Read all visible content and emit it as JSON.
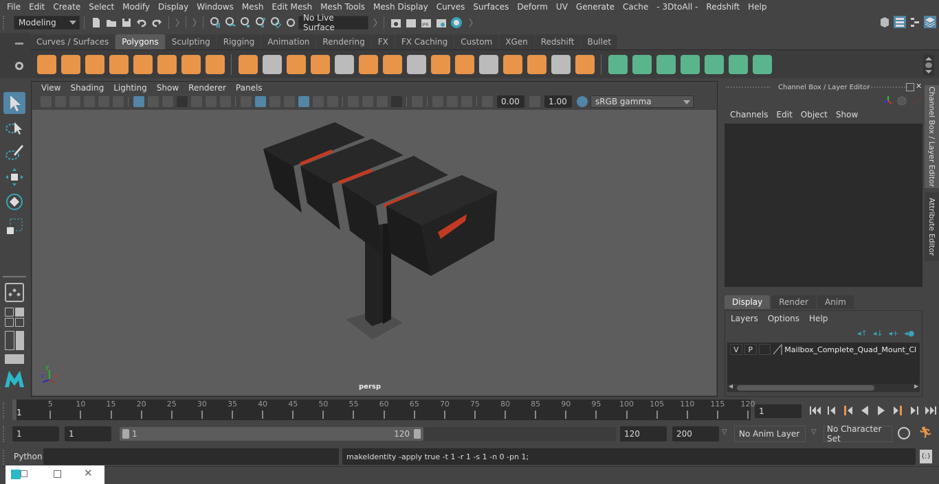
{
  "menubar": {
    "items": [
      "File",
      "Edit",
      "Create",
      "Select",
      "Modify",
      "Display",
      "Windows",
      "Mesh",
      "Edit Mesh",
      "Mesh Tools",
      "Mesh Display",
      "Curves",
      "Surfaces",
      "Deform",
      "UV",
      "Generate",
      "Cache",
      "- 3DtoAll -",
      "Redshift",
      "Help"
    ]
  },
  "statusline": {
    "workspace": "Modeling",
    "live_surface": "No Live Surface"
  },
  "shelf": {
    "tabs": [
      "Curves / Surfaces",
      "Polygons",
      "Sculpting",
      "Rigging",
      "Animation",
      "Rendering",
      "FX",
      "FX Caching",
      "Custom",
      "XGen",
      "Redshift",
      "Bullet"
    ],
    "active_tab": "Polygons",
    "orange_icons": [
      "poly-sphere-icon",
      "poly-cube-icon",
      "poly-cylinder-icon",
      "poly-cone-icon",
      "poly-plane-icon",
      "poly-torus-icon",
      "poly-pyramid-icon",
      "poly-pipe-icon"
    ],
    "edit_icons": [
      "combine-icon",
      "separate-icon",
      "mirror-icon",
      "smooth-icon",
      "extract-icon",
      "bevel-icon",
      "bridge-icon",
      "multicut-icon",
      "extrude-icon",
      "fill-hole-icon",
      "triangulate-icon",
      "merge-icon",
      "edge-loop-icon",
      "target-weld-icon",
      "boolean-icon"
    ],
    "green_icons": [
      "planar-uv-icon",
      "cylindrical-uv-icon",
      "spherical-uv-icon",
      "automatic-uv-icon",
      "unfold-uv-icon",
      "uv-editor-icon",
      "cut-uv-icon"
    ]
  },
  "viewport": {
    "menus": [
      "View",
      "Shading",
      "Lighting",
      "Show",
      "Renderer",
      "Panels"
    ],
    "exposure": "0.00",
    "gamma": "1.00",
    "color_space": "sRGB gamma",
    "camera_label": "persp",
    "axis": {
      "x": "x",
      "y": "y",
      "z": "z"
    }
  },
  "channel_box": {
    "title": "Channel Box / Layer Editor",
    "menus": [
      "Channels",
      "Edit",
      "Object",
      "Show"
    ],
    "layer_tabs": [
      "Display",
      "Render",
      "Anim"
    ],
    "active_layer_tab": "Display",
    "layer_menus": [
      "Layers",
      "Options",
      "Help"
    ],
    "layers": [
      {
        "visible": "V",
        "playback": "P",
        "name": "Mailbox_Complete_Quad_Mount_Clus"
      }
    ]
  },
  "side_tabs": [
    "Channel Box / Layer Editor",
    "Attribute Editor"
  ],
  "timeline": {
    "ticks": [
      5,
      10,
      15,
      20,
      25,
      30,
      35,
      40,
      45,
      50,
      55,
      60,
      65,
      70,
      75,
      80,
      85,
      90,
      95,
      100,
      105,
      110,
      115,
      120
    ],
    "start": 1,
    "end": 120,
    "current_marker": "1",
    "current_frame": "1"
  },
  "range": {
    "start_time": "1",
    "playback_start": "1",
    "slider_start": "1",
    "slider_end": "120",
    "playback_end": "120",
    "end_time": "200",
    "anim_layer": "No Anim Layer",
    "character_set": "No Character Set"
  },
  "command": {
    "language": "Python",
    "input": "",
    "result": "makeIdentity -apply true -t 1 -r 1 -s 1 -n 0 -pn 1;"
  },
  "colors": {
    "accent_blue": "#5285a6",
    "shelf_orange": "#e8954a",
    "shelf_green": "#5bb58c",
    "mailbox_flag": "#c23a22"
  }
}
